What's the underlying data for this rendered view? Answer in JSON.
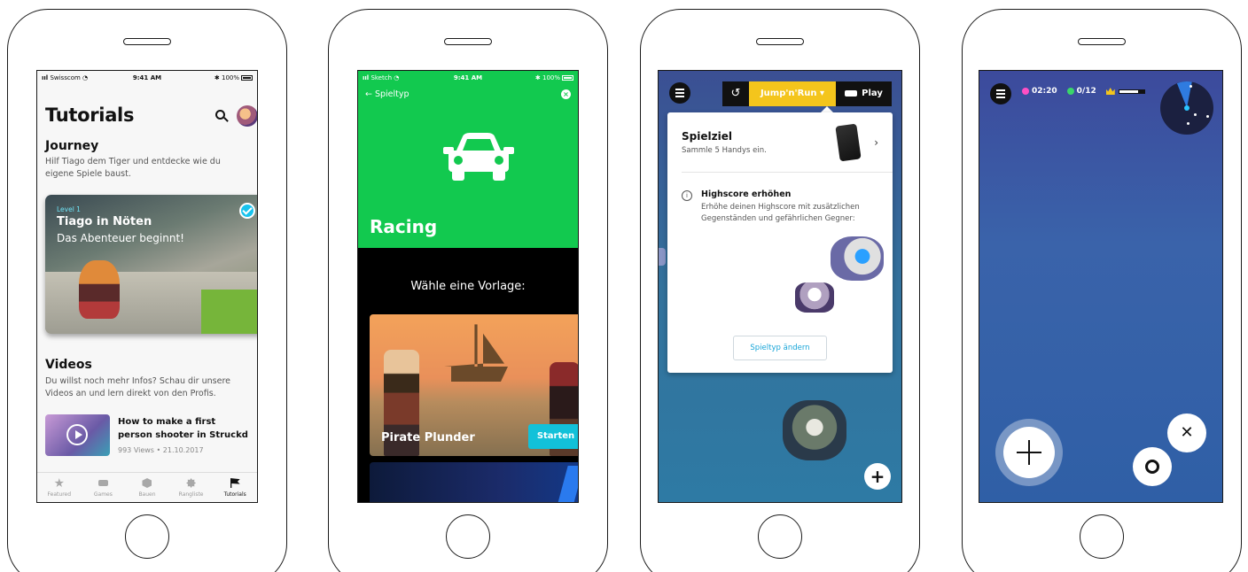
{
  "screen1": {
    "status": {
      "carrier": "Swisscom",
      "time": "9:41 AM",
      "battery": "100%"
    },
    "title": "Tutorials",
    "journey": {
      "heading": "Journey",
      "description": "Hilf Tiago dem Tiger und entdecke wie du eigene Spiele baust.",
      "card": {
        "level": "Level 1",
        "title": "Tiago in Nöten",
        "subtitle": "Das Abenteuer beginnt!",
        "completed": true
      }
    },
    "videos": {
      "heading": "Videos",
      "description": "Du willst noch mehr Infos? Schau dir unsere Videos an und lern direkt von den Profis.",
      "item": {
        "title": "How to make a first person shooter in Struckd",
        "meta": "993 Views • 21.10.2017"
      }
    },
    "tabs": [
      {
        "label": "Featured",
        "icon": "star-icon"
      },
      {
        "label": "Games",
        "icon": "gamepad-icon"
      },
      {
        "label": "Bauen",
        "icon": "cube-icon"
      },
      {
        "label": "Rangliste",
        "icon": "badge-icon"
      },
      {
        "label": "Tutorials",
        "icon": "flag-icon",
        "active": true
      }
    ]
  },
  "screen2": {
    "status": {
      "carrier": "Sketch",
      "time": "9:41 AM",
      "battery": "100%"
    },
    "back_label": "← Spieltyp",
    "close_label": "×",
    "genre": "Racing",
    "accent": "#12c94f",
    "prompt": "Wähle eine Vorlage:",
    "template": {
      "name": "Pirate Plunder",
      "start_label": "Starten"
    }
  },
  "screen3": {
    "undo_label": "↺",
    "mode_label": "Jump'n'Run ▾",
    "play_label": "Play",
    "accent": "#f4c51c",
    "goal": {
      "title": "Spielziel",
      "description": "Sammle 5 Handys ein."
    },
    "highscore": {
      "title": "Highscore erhöhen",
      "description": "Erhöhe deinen Highscore mit zusätzlichen Gegenständen und gefährlichen Gegner:"
    },
    "change_label": "Spieltyp ändern",
    "add_label": "+"
  },
  "screen4": {
    "timer": "02:20",
    "collected": "0/12",
    "progress": 0.75,
    "x_label": "✕"
  }
}
